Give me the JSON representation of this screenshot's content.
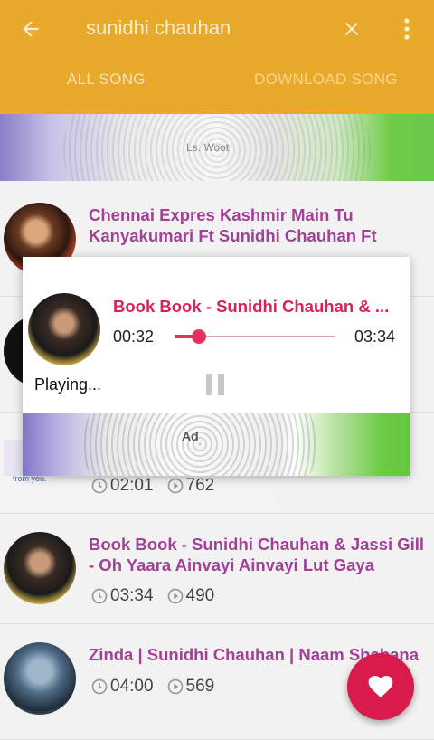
{
  "toolbar": {
    "back_icon": "arrow-left-icon",
    "search_query": "sunidhi chauhan",
    "clear_icon": "close-icon",
    "more_icon": "more-vert-icon"
  },
  "tabs": [
    {
      "label": "ALL SONG",
      "selected": true
    },
    {
      "label": "DOWNLOAD SONG",
      "selected": false
    }
  ],
  "top_ad": {
    "text": "Ls. Woot"
  },
  "songs": [
    {
      "title": "Chennai Expres Kashmir Main Tu Kanyakumari Ft Sunidhi Chauhan Ft",
      "duration": "",
      "plays": ""
    },
    {
      "title": "Book Book - Sunidhi Chauhan & Jassi Gill - Oh Yaara Ainvayi Ainvayi Lut Gaya",
      "duration": "03:34",
      "plays": "490"
    },
    {
      "title": "Zinda | Sunidhi Chauhan | Naam Shabana",
      "duration": "04:00",
      "plays": "569"
    }
  ],
  "ad_row": {
    "duration": "02:01",
    "plays": "762",
    "small_text": "from you."
  },
  "player": {
    "title": "Book Book - Sunidhi Chauhan & ...",
    "current_time": "00:32",
    "total_time": "03:34",
    "progress": 0.15,
    "status": "Playing...",
    "pause_icon": "pause-icon",
    "ad_text": "Ad"
  },
  "fab": {
    "icon": "heart-icon"
  },
  "colors": {
    "app_bar": "#e9a92a",
    "title_purple": "#a23f98",
    "player_accent": "#e0345f",
    "fab": "#d81b4a"
  }
}
